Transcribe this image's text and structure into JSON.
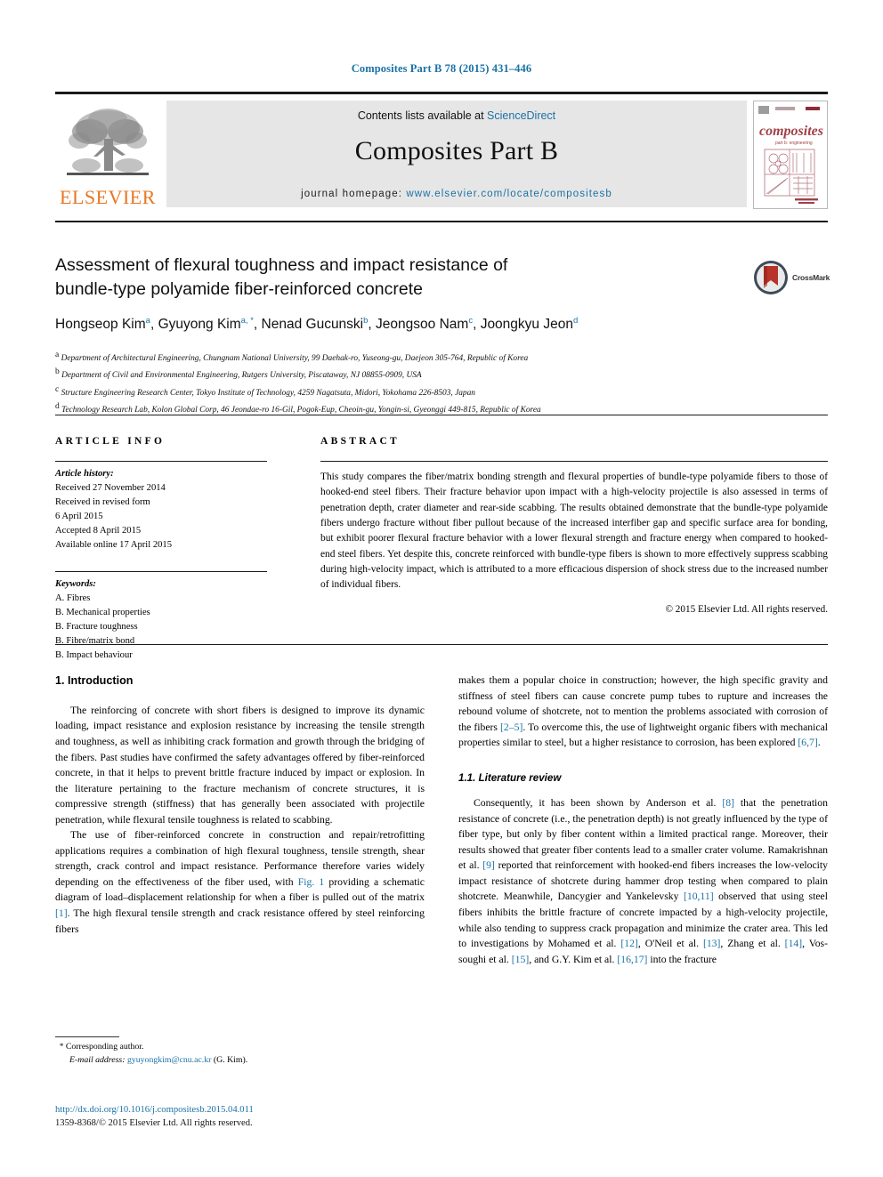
{
  "running_head": "Composites Part B 78 (2015) 431–446",
  "masthead": {
    "publisher_name": "ELSEVIER",
    "contents_prefix": "Contents lists available at ",
    "contents_link": "ScienceDirect",
    "journal_name": "Composites Part B",
    "homepage_label": "journal homepage: ",
    "homepage_url": "www.elsevier.com/locate/compositesb",
    "cover_title": "composites",
    "cover_subtitle": "part b: engineering"
  },
  "article": {
    "title_line1": "Assessment of flexural toughness and impact resistance of",
    "title_line2": "bundle-type polyamide fiber-reinforced concrete",
    "crossmark_label": "CrossMark",
    "authors": [
      {
        "name": "Hongseop Kim",
        "marks": "a"
      },
      {
        "name": "Gyuyong Kim",
        "marks": "a, *"
      },
      {
        "name": "Nenad Gucunski",
        "marks": "b"
      },
      {
        "name": "Jeongsoo Nam",
        "marks": "c"
      },
      {
        "name": "Joongkyu Jeon",
        "marks": "d"
      }
    ],
    "affiliations": [
      {
        "mark": "a",
        "text": "Department of Architectural Engineering, Chungnam National University, 99 Daehak-ro, Yuseong-gu, Daejeon 305-764, Republic of Korea"
      },
      {
        "mark": "b",
        "text": "Department of Civil and Environmental Engineering, Rutgers University, Piscataway, NJ 08855-0909, USA"
      },
      {
        "mark": "c",
        "text": "Structure Engineering Research Center, Tokyo Institute of Technology, 4259 Nagatsuta, Midori, Yokohama 226-8503, Japan"
      },
      {
        "mark": "d",
        "text": "Technology Research Lab, Kolon Global Corp, 46 Jeondae-ro 16-Gil, Pogok-Eup, Cheoin-gu, Yongin-si, Gyeonggi 449-815, Republic of Korea"
      }
    ]
  },
  "article_info": {
    "heading": "ARTICLE INFO",
    "history_label": "Article history:",
    "history": [
      "Received 27 November 2014",
      "Received in revised form",
      "6 April 2015",
      "Accepted 8 April 2015",
      "Available online 17 April 2015"
    ],
    "keywords_label": "Keywords:",
    "keywords": [
      "A. Fibres",
      "B. Mechanical properties",
      "B. Fracture toughness",
      "B. Fibre/matrix bond",
      "B. Impact behaviour"
    ]
  },
  "abstract": {
    "heading": "ABSTRACT",
    "text": "This study compares the fiber/matrix bonding strength and flexural properties of bundle-type polyamide fibers to those of hooked-end steel fibers. Their fracture behavior upon impact with a high-velocity projectile is also assessed in terms of penetration depth, crater diameter and rear-side scabbing. The results obtained demonstrate that the bundle-type polyamide fibers undergo fracture without fiber pullout because of the increased interfiber gap and specific surface area for bonding, but exhibit poorer flexural fracture behavior with a lower flexural strength and fracture energy when compared to hooked-end steel fibers. Yet despite this, concrete reinforced with bundle-type fibers is shown to more effectively suppress scabbing during high-velocity impact, which is attributed to a more efficacious dispersion of shock stress due to the increased number of individual fibers.",
    "copyright": "© 2015 Elsevier Ltd. All rights reserved."
  },
  "body": {
    "section1_heading": "1. Introduction",
    "left_para1": "The reinforcing of concrete with short fibers is designed to improve its dynamic loading, impact resistance and explosion resistance by increasing the tensile strength and toughness, as well as inhibiting crack formation and growth through the bridging of the fibers. Past studies have confirmed the safety advantages offered by fiber-reinforced concrete, in that it helps to prevent brittle fracture induced by impact or explosion. In the literature pertaining to the fracture mechanism of concrete structures, it is compressive strength (stiffness) that has generally been associated with projectile penetration, while flexural tensile toughness is related to scabbing.",
    "left_para2_a": "The use of fiber-reinforced concrete in construction and repair/retrofitting applications requires a combination of high flexural toughness, tensile strength, shear strength, crack control and impact resistance. Performance therefore varies widely depending on the effectiveness of the fiber used, with ",
    "left_para2_ref1": "Fig. 1",
    "left_para2_b": " providing a schematic diagram of load–displacement relationship for when a fiber is pulled out of the matrix ",
    "left_para2_ref2": "[1]",
    "left_para2_c": ". The high flexural tensile strength and crack resistance offered by steel reinforcing fibers",
    "right_para1_a": "makes them a popular choice in construction; however, the high specific gravity and stiffness of steel fibers can cause concrete pump tubes to rupture and increases the rebound volume of shotcrete, not to mention the problems associated with corrosion of the fibers ",
    "right_para1_ref1": "[2–5]",
    "right_para1_b": ". To overcome this, the use of lightweight organic fibers with mechanical properties similar to steel, but a higher resistance to corrosion, has been explored ",
    "right_para1_ref2": "[6,7]",
    "right_para1_c": ".",
    "subsection_heading": "1.1. Literature review",
    "right_para2_a": "Consequently, it has been shown by Anderson et al. ",
    "right_para2_ref1": "[8]",
    "right_para2_b": " that the penetration resistance of concrete (i.e., the penetration depth) is not greatly influenced by the type of fiber type, but only by fiber content within a limited practical range. Moreover, their results showed that greater fiber contents lead to a smaller crater volume. Ramakrishnan et al. ",
    "right_para2_ref2": "[9]",
    "right_para2_c": " reported that reinforcement with hooked-end fibers increases the low-velocity impact resistance of shotcrete during hammer drop testing when compared to plain shotcrete. Meanwhile, Dancygier and Yankelevsky ",
    "right_para2_ref3": "[10,11]",
    "right_para2_d": " observed that using steel fibers inhibits the brittle fracture of concrete impacted by a high-velocity projectile, while also tending to suppress crack propagation and minimize the crater area. This led to investigations by Mohamed et al. ",
    "right_para2_ref4": "[12]",
    "right_para2_e": ", O'Neil et al. ",
    "right_para2_ref5": "[13]",
    "right_para2_f": ", Zhang et al. ",
    "right_para2_ref6": "[14]",
    "right_para2_g": ", Vos-soughi et al. ",
    "right_para2_ref7": "[15]",
    "right_para2_h": ", and G.Y. Kim et al. ",
    "right_para2_ref8": "[16,17]",
    "right_para2_i": " into the fracture"
  },
  "footnote": {
    "star": "*",
    "corresponding": "Corresponding author.",
    "email_label": "E-mail address:",
    "email": "gyuyongkim@cnu.ac.kr",
    "email_suffix": "(G. Kim)."
  },
  "footer": {
    "doi": "http://dx.doi.org/10.1016/j.compositesb.2015.04.011",
    "issn_line": "1359-8368/© 2015 Elsevier Ltd. All rights reserved."
  },
  "colors": {
    "link_blue": "#1b72a6",
    "elsevier_orange": "#E87722",
    "band_gray": "#e6e6e6",
    "crossmark_red": "#b8342a"
  }
}
